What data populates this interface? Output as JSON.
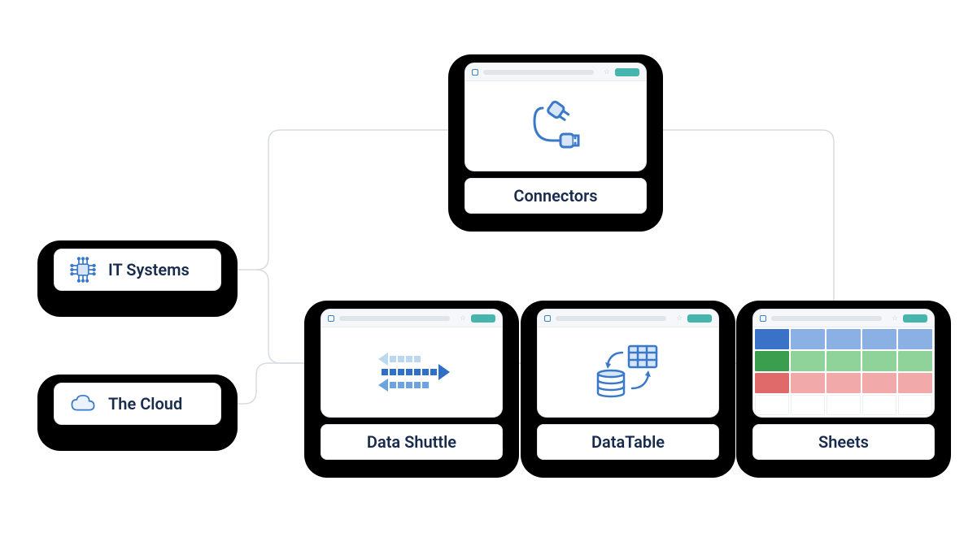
{
  "nodes": {
    "it_systems": {
      "label": "IT Systems",
      "icon": "chip-icon"
    },
    "the_cloud": {
      "label": "The Cloud",
      "icon": "cloud-icon"
    },
    "connectors": {
      "label": "Connectors",
      "icon": "plugs-icon"
    },
    "data_shuttle": {
      "label": "Data Shuttle",
      "icon": "transfer-arrows-icon"
    },
    "datatable": {
      "label": "DataTable",
      "icon": "db-table-sync-icon"
    },
    "sheets": {
      "label": "Sheets",
      "icon": "spreadsheet-icon"
    }
  },
  "colors": {
    "text": "#172b4d",
    "icon_blue": "#3a78c9",
    "icon_blue_light": "#9fc1e8",
    "accent_teal": "#46b5ad",
    "connector_line": "#d8dce2"
  },
  "edges": [
    [
      "it_systems",
      "connectors"
    ],
    [
      "it_systems",
      "data_shuttle"
    ],
    [
      "the_cloud",
      "data_shuttle"
    ],
    [
      "connectors",
      "sheets"
    ],
    [
      "data_shuttle",
      "datatable"
    ],
    [
      "datatable",
      "sheets"
    ]
  ]
}
